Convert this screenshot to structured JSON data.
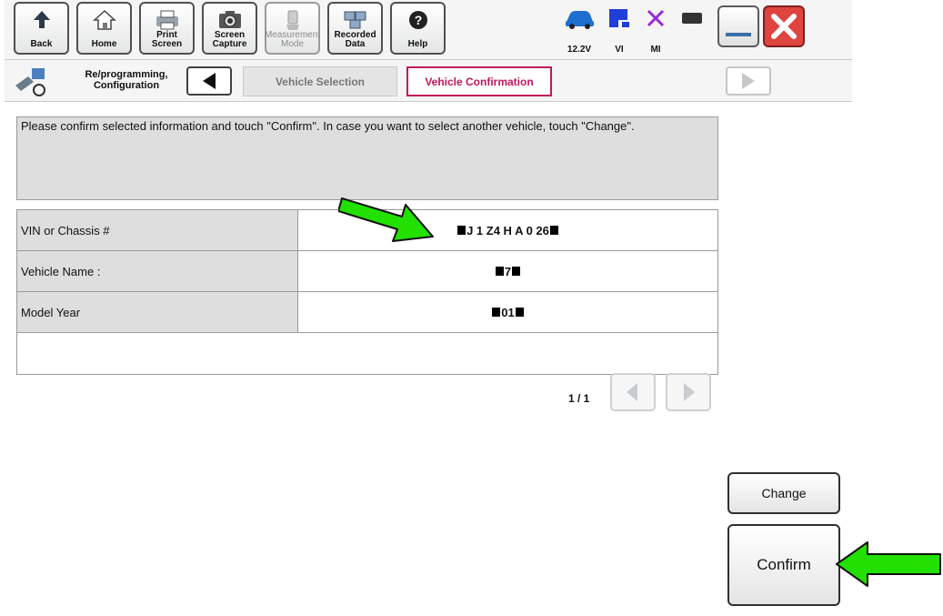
{
  "toolbar": {
    "buttons": [
      {
        "label": "Back"
      },
      {
        "label": "Home"
      },
      {
        "label": "Print Screen"
      },
      {
        "label": "Screen Capture"
      },
      {
        "label": "Measurement Mode"
      },
      {
        "label": "Recorded Data"
      },
      {
        "label": "Help"
      }
    ],
    "status": {
      "voltage": "12.2V",
      "vi": "VI",
      "mi": "MI"
    }
  },
  "breadcrumb": {
    "section": "Re/programming, Configuration",
    "steps": [
      "Vehicle Selection",
      "Vehicle Confirmation"
    ]
  },
  "message": "Please confirm selected information and touch \"Confirm\". In case you want to select another vehicle, touch \"Change\".",
  "vehicle_table": {
    "rows": [
      {
        "label": "VIN or Chassis #",
        "value": "J 1 Z4 H A 0 26"
      },
      {
        "label": "Vehicle Name :",
        "value": "7"
      },
      {
        "label": "Model Year",
        "value": "01"
      },
      {
        "label": "",
        "value": ""
      }
    ]
  },
  "pager": {
    "text": "1 / 1"
  },
  "actions": {
    "change": "Change",
    "confirm": "Confirm"
  },
  "colors": {
    "active_crumb": "#c2185b",
    "arrow": "#22e000",
    "close": "#e0443f"
  }
}
